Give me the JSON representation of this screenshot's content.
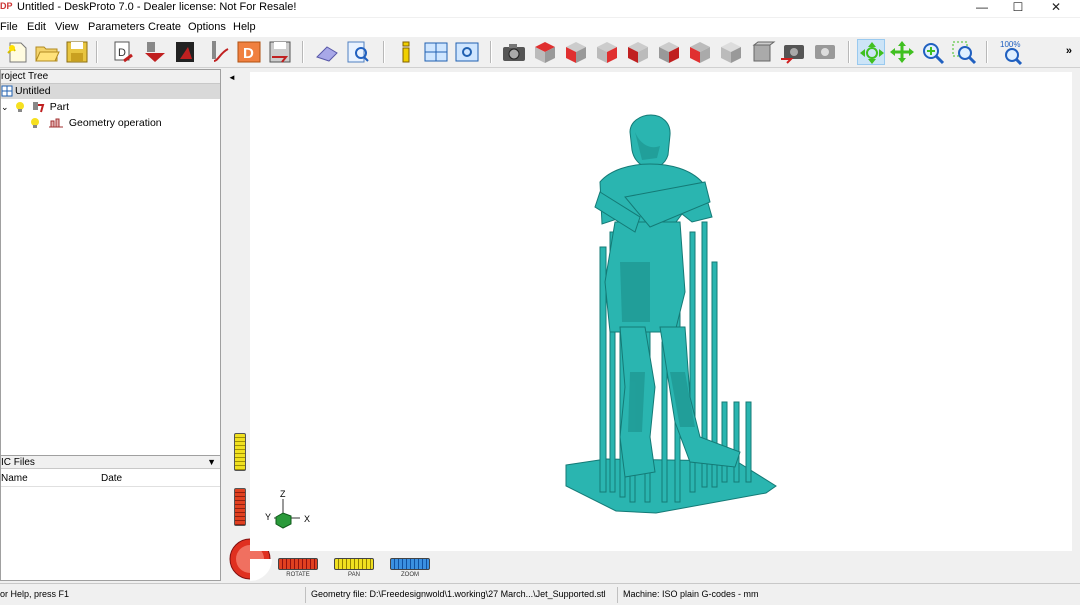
{
  "window": {
    "app_icon_text": "DP",
    "title": "Untitled - DeskProto 7.0 - Dealer license: Not For Resale!",
    "minimize": "—",
    "maximize": "☐",
    "close": "✕"
  },
  "menu": {
    "file": "File",
    "edit": "Edit",
    "view": "View",
    "parameters": "Parameters",
    "create": "Create",
    "options": "Options",
    "help": "Help"
  },
  "toolbar": {
    "more": "»",
    "zoom_100_label": "100%"
  },
  "project_tree": {
    "header": "roject Tree",
    "root": "Untitled",
    "part": "Part",
    "geometry_operation": "Geometry operation"
  },
  "nc_files": {
    "header": "IC Files",
    "col_name": "Name",
    "col_date": "Date"
  },
  "viewport": {
    "collapse_arrow": "◄",
    "axis_z": "Z",
    "axis_y": "Y",
    "axis_x": "X",
    "rotate_label": "ROTATE",
    "pan_label": "PAN",
    "zoom_label": "ZOOM"
  },
  "colors": {
    "model": "#2ab5b0",
    "model_dark": "#1a8c88",
    "rotate": "#d03020",
    "pan": "#e0d010",
    "zoom": "#2a7fd0"
  },
  "status": {
    "help": "or Help, press F1",
    "geometry_file": "Geometry file: D:\\Freedesignwold\\1.working\\27 March...\\Jet_Supported.stl",
    "machine": "Machine: ISO plain G-codes - mm"
  }
}
